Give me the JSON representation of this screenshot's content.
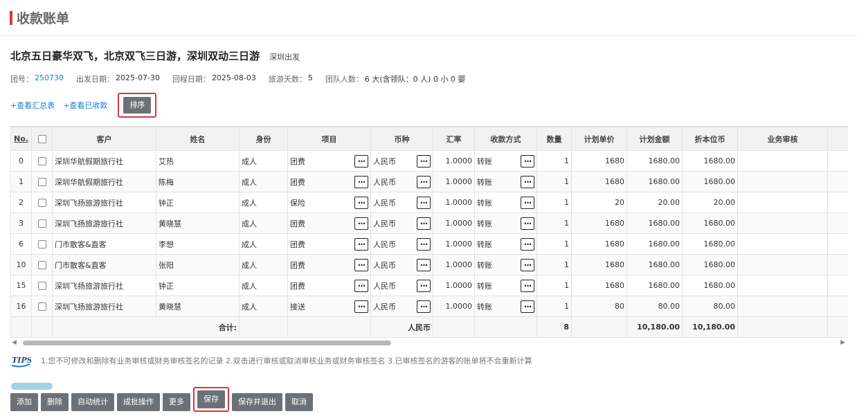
{
  "page": {
    "title": "收款账单"
  },
  "trip": {
    "title": "北京五日豪华双飞，北京双飞三日游，深圳双动三日游",
    "departure_tag": "深圳出发"
  },
  "info": {
    "group_no_label": "团号：",
    "group_no": "250730",
    "depart_label": "出发日期：",
    "depart_date": "2025-07-30",
    "return_label": "回程日期：",
    "return_date": "2025-08-03",
    "days_label": "旅游天数：",
    "days": "5",
    "people_label": "团队人数：",
    "people": "6 大(含领队：0 人) 0 小 0 婴"
  },
  "links": {
    "summary": "+查看汇总表",
    "received": "+查看已收款",
    "sort_button": "排序"
  },
  "columns": {
    "no": "No.",
    "customer": "客户",
    "name": "姓名",
    "identity": "身份",
    "item": "项目",
    "currency": "币种",
    "rate": "汇率",
    "method": "收款方式",
    "qty": "数量",
    "unit_price": "计划单价",
    "amount": "计划金额",
    "local": "折本位币",
    "audit": "业务审核"
  },
  "rows": [
    {
      "no": "0",
      "customer": "深圳华航假期旅行社",
      "name": "艾热",
      "identity": "成人",
      "item": "团费",
      "currency": "人民币",
      "rate": "1.0000",
      "method": "转账",
      "qty": "1",
      "unit_price": "1680",
      "amount": "1680.00",
      "local": "1680.00"
    },
    {
      "no": "1",
      "customer": "深圳华航假期旅行社",
      "name": "陈梅",
      "identity": "成人",
      "item": "团费",
      "currency": "人民币",
      "rate": "1.0000",
      "method": "转账",
      "qty": "1",
      "unit_price": "1680",
      "amount": "1680.00",
      "local": "1680.00"
    },
    {
      "no": "2",
      "customer": "深圳飞扬旅游旅行社",
      "name": "钟正",
      "identity": "成人",
      "item": "保险",
      "currency": "人民币",
      "rate": "1.0000",
      "method": "转账",
      "qty": "1",
      "unit_price": "20",
      "amount": "20.00",
      "local": "20.00"
    },
    {
      "no": "3",
      "customer": "深圳飞扬旅游旅行社",
      "name": "黄晓慧",
      "identity": "成人",
      "item": "团费",
      "currency": "人民币",
      "rate": "1.0000",
      "method": "转账",
      "qty": "1",
      "unit_price": "1680",
      "amount": "1680.00",
      "local": "1680.00"
    },
    {
      "no": "6",
      "customer": "门市散客&直客",
      "name": "李想",
      "identity": "成人",
      "item": "团费",
      "currency": "人民币",
      "rate": "1.0000",
      "method": "转账",
      "qty": "1",
      "unit_price": "1680",
      "amount": "1680.00",
      "local": "1680.00"
    },
    {
      "no": "10",
      "customer": "门市散客&直客",
      "name": "张阳",
      "identity": "成人",
      "item": "团费",
      "currency": "人民币",
      "rate": "1.0000",
      "method": "转账",
      "qty": "1",
      "unit_price": "1680",
      "amount": "1680.00",
      "local": "1680.00"
    },
    {
      "no": "15",
      "customer": "深圳飞扬旅游旅行社",
      "name": "钟正",
      "identity": "成人",
      "item": "团费",
      "currency": "人民币",
      "rate": "1.0000",
      "method": "转账",
      "qty": "1",
      "unit_price": "1680",
      "amount": "1680.00",
      "local": "1680.00"
    },
    {
      "no": "16",
      "customer": "深圳飞扬旅游旅行社",
      "name": "黄晓慧",
      "identity": "成人",
      "item": "接送",
      "currency": "人民币",
      "rate": "1.0000",
      "method": "转账",
      "qty": "1",
      "unit_price": "80",
      "amount": "80.00",
      "local": "80.00"
    }
  ],
  "totals": {
    "label": "合计:",
    "currency": "人民币",
    "qty": "8",
    "amount": "10,180.00",
    "local": "10,180.00"
  },
  "tips": {
    "icon_text": "TIPS",
    "text": "1.您不可修改和删除有业务审核或财务审核签名的记录  2.双击进行审核或取消审核业务或财务审核签名  3.已审核签名的游客的账单将不会重新计算"
  },
  "buttons": {
    "add": "添加",
    "delete": "删除",
    "auto_stats": "自动统计",
    "batch": "成批操作",
    "more": "更多",
    "save": "保存",
    "save_exit": "保存并退出",
    "cancel": "取消"
  },
  "colors": {
    "accent_red": "#d9363e",
    "link_blue": "#1a7bd6",
    "button_gray": "#6b7177"
  }
}
